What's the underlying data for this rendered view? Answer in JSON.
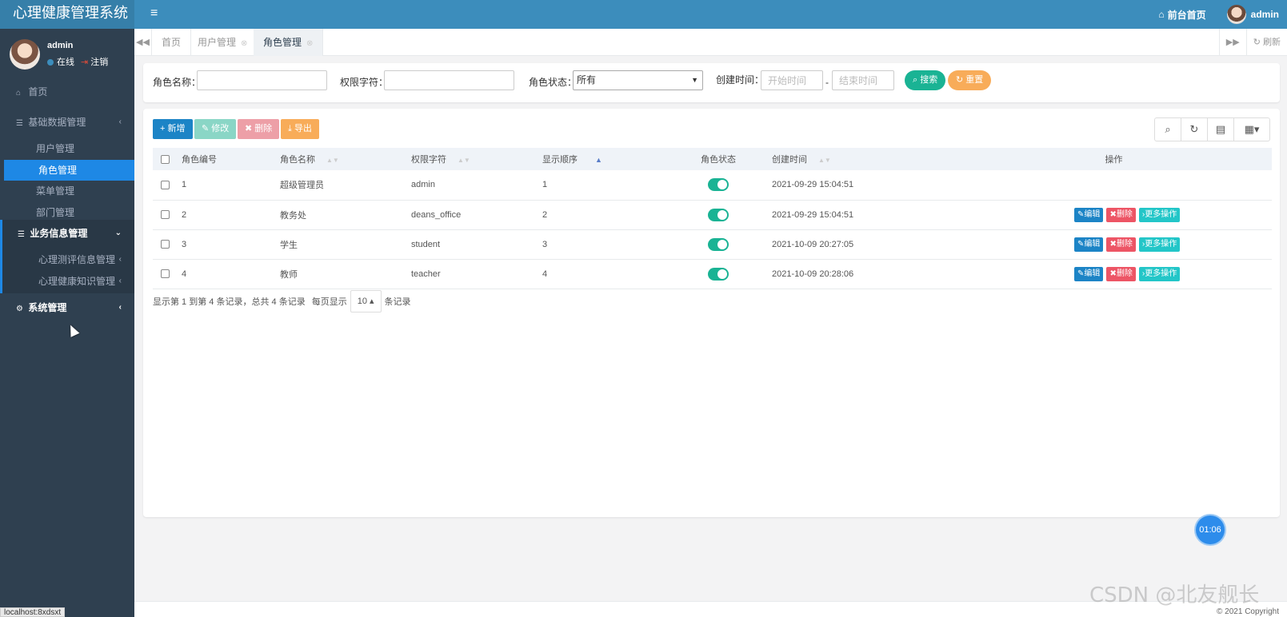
{
  "app": {
    "title": "心理健康管理系统"
  },
  "header": {
    "frontend_link": "前台首页",
    "user_name": "admin"
  },
  "sidebar": {
    "user": {
      "name": "admin",
      "online": "在线",
      "logout": "注销"
    },
    "home": "首页",
    "basic_data": "基础数据管理",
    "basic_items": [
      "用户管理",
      "角色管理",
      "菜单管理",
      "部门管理"
    ],
    "business": "业务信息管理",
    "business_items": [
      "心理测评信息管理",
      "心理健康知识管理"
    ],
    "system": "系统管理"
  },
  "tabs": {
    "items": [
      "首页",
      "用户管理",
      "角色管理"
    ],
    "refresh": "刷新"
  },
  "search": {
    "role_name_label": "角色名称：",
    "permission_label": "权限字符：",
    "status_label": "角色状态：",
    "status_value": "所有",
    "created_label": "创建时间：",
    "start_placeholder": "开始时间",
    "end_placeholder": "结束时间",
    "date_sep": "-",
    "search_btn": "搜索",
    "reset_btn": "重置"
  },
  "toolbar": {
    "add": "新增",
    "edit": "修改",
    "delete": "删除",
    "export": "导出"
  },
  "table": {
    "headers": [
      "角色编号",
      "角色名称",
      "权限字符",
      "显示顺序",
      "角色状态",
      "创建时间",
      "操作"
    ],
    "rows": [
      {
        "id": "1",
        "name": "超级管理员",
        "key": "admin",
        "order": "1",
        "created": "2021-09-29 15:04:51",
        "ops": false
      },
      {
        "id": "2",
        "name": "教务处",
        "key": "deans_office",
        "order": "2",
        "created": "2021-09-29 15:04:51",
        "ops": true
      },
      {
        "id": "3",
        "name": "学生",
        "key": "student",
        "order": "3",
        "created": "2021-10-09 20:27:05",
        "ops": true
      },
      {
        "id": "4",
        "name": "教师",
        "key": "teacher",
        "order": "4",
        "created": "2021-10-09 20:28:06",
        "ops": true
      }
    ],
    "op_edit": "编辑",
    "op_delete": "删除",
    "op_more": "更多操作"
  },
  "pager": {
    "summary": "显示第 1 到第 4 条记录，总共 4 条记录",
    "per_page_label": "每页显示",
    "page_size": "10",
    "unit": "条记录"
  },
  "timer": "01:06",
  "footer": {
    "copyright": "© 2021 Copyright"
  },
  "watermark": "CSDN @北友舰长",
  "status_bar": "localhost:8xdsxt"
}
